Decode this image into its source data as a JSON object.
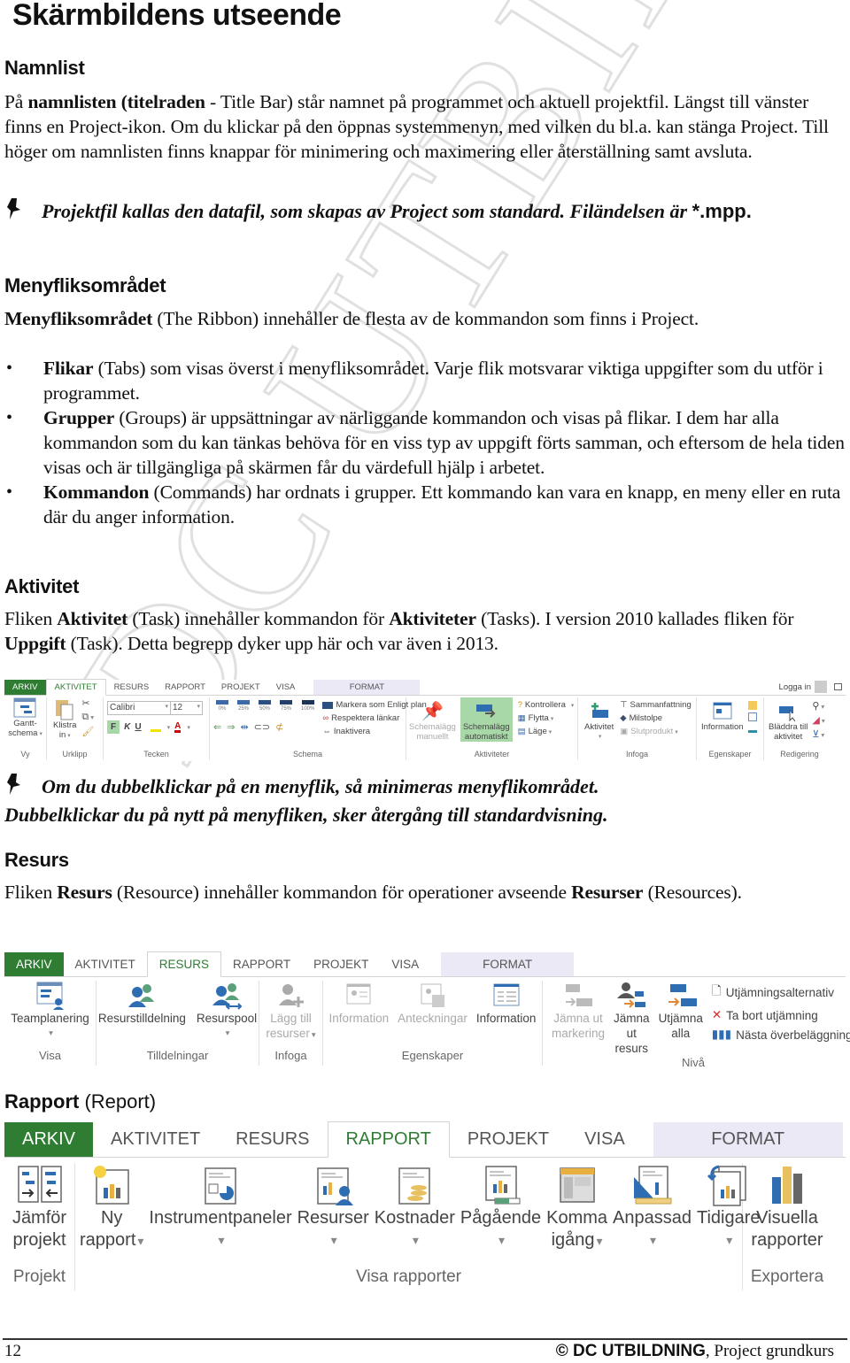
{
  "page": {
    "title": "Skärmbildens utseende",
    "watermark": "DC UTBILDNING"
  },
  "namnlist": {
    "heading": "Namnlist",
    "p1_a": "På ",
    "p1_b": "namnlisten (titelraden",
    "p1_c": " - Title Bar) står namnet på programmet och aktuell projektfil. Längst till vänster finns en Project-ikon. Om du klickar på den öppnas systemmenyn, med vilken du bl.a. kan stänga Project. Till höger om namnlisten finns knappar för minimering och maximering eller återställning samt avsluta.",
    "note_a": "Projektfil kallas den datafil, som skapas av Project som standard. Filändelsen är ",
    "note_b": "*.mpp."
  },
  "menyflik": {
    "heading": "Menyfliksområdet",
    "p1_bold": "Menyfliksområdet",
    "p1_rest": " (The Ribbon) innehåller de flesta av de kommandon som finns i Project.",
    "bullets": [
      {
        "bold": "Flikar",
        "rest": " (Tabs) som visas överst i menyfliksområdet. Varje flik motsvarar viktiga uppgifter som du utför i programmet."
      },
      {
        "bold": "Grupper",
        "rest": " (Groups) är uppsättningar av närliggande kommandon och visas på flikar. I dem har alla kommandon som du kan tänkas behöva för en viss typ av uppgift förts samman, och eftersom de hela tiden visas och är tillgängliga på skärmen får du värdefull hjälp i arbetet."
      },
      {
        "bold": "Kommandon",
        "rest": " (Commands) har ordnats i grupper. Ett kommando kan vara en knapp, en meny eller en ruta där du anger information."
      }
    ]
  },
  "aktivitet": {
    "heading": "Aktivitet",
    "p_a": "Fliken ",
    "p_b": "Aktivitet",
    "p_c": " (Task) innehåller kommandon för ",
    "p_d": "Aktiviteter",
    "p_e": " (Tasks). I version 2010 kallades fliken för ",
    "p_f": "Uppgift",
    "p_g": " (Task). Detta begrepp dyker upp här och var även i 2013.",
    "note_a": "Om du dubbelklickar på en menyflik, så minimeras menyflikområdet.",
    "note_b": "Dubbelklickar du på nytt på menyfliken, sker återgång till standardvisning."
  },
  "ribbon_tabs": [
    "ARKIV",
    "AKTIVITET",
    "RESURS",
    "RAPPORT",
    "PROJEKT",
    "VISA",
    "FORMAT"
  ],
  "ribbon1": {
    "login": "Logga in",
    "vy": {
      "label": "Vy",
      "gantt": "Gantt-",
      "gantt2": "schema"
    },
    "urklipp": {
      "label": "Urklipp",
      "paste": "Klistra",
      "paste2": "in"
    },
    "tecken": {
      "label": "Tecken",
      "font": "Calibri",
      "size": "12",
      "bold": "F",
      "italic": "K",
      "underline": "U"
    },
    "schema": {
      "label": "Schema",
      "percents": [
        "0%",
        "25%",
        "50%",
        "75%",
        "100%"
      ],
      "mark_on_track": "Markera som Enligt plan",
      "respect_links": "Respektera länkar",
      "inactivate": "Inaktivera"
    },
    "aktiviteter": {
      "label": "Aktiviteter",
      "manual1": "Schemalägg",
      "manual2": "manuellt",
      "auto1": "Schemalägg",
      "auto2": "automatiskt",
      "inspect": "Kontrollera",
      "move": "Flytta",
      "mode": "Läge"
    },
    "infoga": {
      "label": "Infoga",
      "task": "Aktivitet",
      "summary": "Sammanfattning",
      "milestone": "Milstolpe",
      "deliverable": "Slutprodukt"
    },
    "egenskaper": {
      "label": "Egenskaper",
      "information": "Information"
    },
    "redigering": {
      "label": "Redigering",
      "scroll1": "Bläddra till",
      "scroll2": "aktivitet"
    }
  },
  "resurs": {
    "heading": "Resurs",
    "p_a": "Fliken ",
    "p_b": "Resurs",
    "p_c": " (Resource) innehåller kommandon för operationer avseende ",
    "p_d": "Resurser",
    "p_e": " (Resources)."
  },
  "ribbon2": {
    "visa": {
      "label": "Visa",
      "team": "Teamplanering"
    },
    "tilldelningar": {
      "label": "Tilldelningar",
      "assign": "Resurstilldelning",
      "pool": "Resurspool"
    },
    "infoga": {
      "label": "Infoga",
      "add1": "Lägg till",
      "add2": "resurser"
    },
    "egenskaper": {
      "label": "Egenskaper",
      "info": "Information",
      "notes": "Anteckningar",
      "details": "Information"
    },
    "niva": {
      "label": "Nivå",
      "sel1": "Jämna ut",
      "sel2": "markering",
      "res1": "Jämna",
      "res2": "ut resurs",
      "all1": "Utjämna",
      "all2": "alla",
      "options": "Utjämningsalternativ",
      "clear": "Ta bort utjämning",
      "next": "Nästa överbeläggning"
    }
  },
  "rapport": {
    "heading_bold": "Rapport",
    "heading_rest": " (Report)"
  },
  "ribbon3": {
    "projekt": {
      "label": "Projekt",
      "compare1": "Jämför",
      "compare2": "projekt"
    },
    "visa": {
      "label": "Visa rapporter",
      "new1": "Ny",
      "new2": "rapport",
      "dash": "Instrumentpaneler",
      "res": "Resurser",
      "cost": "Kostnader",
      "progress": "Pågående",
      "start1": "Komma",
      "start2": "igång",
      "custom": "Anpassad",
      "recent": "Tidigare"
    },
    "exportera": {
      "label": "Exportera",
      "visual1": "Visuella",
      "visual2": "rapporter"
    }
  },
  "footer": {
    "page_number": "12",
    "copyright": "© DC UTBILDNING",
    "course": ", Project grundkurs"
  },
  "colors": {
    "arkiv_green": "#2e7d32",
    "active_tab_text": "#2e7d32",
    "format_tab_bg": "#ece9f7",
    "highlight_green": "#a9d8a8",
    "icon_blue": "#2f6db3"
  }
}
